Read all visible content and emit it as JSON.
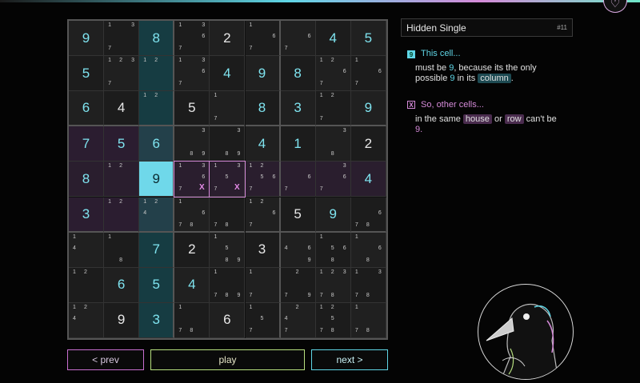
{
  "top_button": {
    "icon": "heart-icon",
    "glyph": "♡"
  },
  "hint": {
    "title": "Hidden Single",
    "number": "#11",
    "step1": {
      "box": "9",
      "title": "This cell...",
      "line1_pre": "must be ",
      "line1_val": "9",
      "line1_post": ", because its the only",
      "line2_pre": "possible ",
      "line2_val": "9",
      "line2_mid": " in its ",
      "line2_chip": "column",
      "line2_post": "."
    },
    "step2": {
      "box": "X",
      "title": "So, other cells...",
      "line1_pre": "in the same ",
      "line1_chip1": "house",
      "line1_mid": " or ",
      "line1_chip2": "row",
      "line1_post": " can't be",
      "line2_val": "9."
    }
  },
  "controls": {
    "prev": "< prev",
    "play": "play",
    "next": "next >"
  },
  "colors": {
    "accent_blue": "#5fd6e6",
    "accent_pink": "#d48ad8",
    "accent_green": "#b7e07f"
  },
  "board": {
    "rows": [
      [
        {
          "v": "9"
        },
        {
          "c": [
            "1",
            "3",
            "7"
          ]
        },
        {
          "v": "8",
          "bg": "col"
        },
        {
          "c": [
            "1",
            "3",
            "6",
            "7"
          ]
        },
        {
          "v": "2",
          "f": 1
        },
        {
          "c": [
            "1",
            "6",
            "7"
          ]
        },
        {
          "c": [
            "6",
            "7"
          ]
        },
        {
          "v": "4"
        },
        {
          "v": "5"
        }
      ],
      [
        {
          "v": "5"
        },
        {
          "c": [
            "1",
            "2",
            "3",
            "7"
          ]
        },
        {
          "c": [
            "1",
            "2"
          ],
          "bg": "col"
        },
        {
          "c": [
            "1",
            "3",
            "6",
            "7"
          ]
        },
        {
          "v": "4"
        },
        {
          "v": "9"
        },
        {
          "v": "8"
        },
        {
          "c": [
            "1",
            "2",
            "6",
            "7"
          ]
        },
        {
          "c": [
            "1",
            "6",
            "7"
          ]
        }
      ],
      [
        {
          "v": "6"
        },
        {
          "v": "4",
          "f": 1
        },
        {
          "c": [
            "1",
            "2"
          ],
          "bg": "col"
        },
        {
          "v": "5",
          "f": 1
        },
        {
          "c": [
            "1",
            "7"
          ]
        },
        {
          "v": "8"
        },
        {
          "v": "3"
        },
        {
          "c": [
            "1",
            "2",
            "7"
          ]
        },
        {
          "v": "9"
        }
      ],
      [
        {
          "v": "7",
          "bg": "box"
        },
        {
          "v": "5",
          "bg": "box"
        },
        {
          "v": "6",
          "bg": "boxcol"
        },
        {
          "c": [
            "3",
            "8",
            "9"
          ]
        },
        {
          "c": [
            "3",
            "8",
            "9"
          ]
        },
        {
          "v": "4"
        },
        {
          "v": "1"
        },
        {
          "c": [
            "3",
            "8"
          ]
        },
        {
          "v": "2",
          "f": 1
        }
      ],
      [
        {
          "v": "8",
          "bg": "row"
        },
        {
          "c": [
            "1",
            "2"
          ],
          "bg": "row"
        },
        {
          "v": "9",
          "bg": "target"
        },
        {
          "c": [
            "1",
            "3",
            "6",
            "7",
            "X"
          ],
          "bg": "rowsel"
        },
        {
          "c": [
            "1",
            "3",
            "5",
            "7",
            "X"
          ],
          "bg": "rowsel"
        },
        {
          "c": [
            "1",
            "2",
            "5",
            "6",
            "7"
          ],
          "bg": "row"
        },
        {
          "c": [
            "6",
            "7"
          ],
          "bg": "row"
        },
        {
          "c": [
            "3",
            "6",
            "7"
          ],
          "bg": "row"
        },
        {
          "v": "4",
          "bg": "row"
        }
      ],
      [
        {
          "v": "3",
          "bg": "box"
        },
        {
          "c": [
            "1",
            "2"
          ],
          "bg": "box"
        },
        {
          "c": [
            "1",
            "2",
            "4"
          ],
          "bg": "boxcol"
        },
        {
          "c": [
            "1",
            "6",
            "7",
            "8"
          ]
        },
        {
          "c": [
            "7",
            "8"
          ]
        },
        {
          "c": [
            "1",
            "2",
            "6",
            "7"
          ]
        },
        {
          "v": "5",
          "f": 1
        },
        {
          "v": "9"
        },
        {
          "c": [
            "6",
            "7",
            "8"
          ]
        }
      ],
      [
        {
          "c": [
            "1",
            "4"
          ]
        },
        {
          "c": [
            "1",
            "8"
          ]
        },
        {
          "v": "7",
          "bg": "col"
        },
        {
          "v": "2",
          "f": 1
        },
        {
          "c": [
            "1",
            "5",
            "8",
            "9"
          ]
        },
        {
          "v": "3",
          "f": 1
        },
        {
          "c": [
            "4",
            "6",
            "9"
          ]
        },
        {
          "c": [
            "1",
            "5",
            "6",
            "8"
          ]
        },
        {
          "c": [
            "1",
            "6",
            "8"
          ]
        }
      ],
      [
        {
          "c": [
            "1",
            "2"
          ]
        },
        {
          "v": "6"
        },
        {
          "v": "5",
          "bg": "col"
        },
        {
          "v": "4"
        },
        {
          "c": [
            "1",
            "7",
            "8",
            "9"
          ]
        },
        {
          "c": [
            "1",
            "7"
          ]
        },
        {
          "c": [
            "2",
            "7",
            "9"
          ]
        },
        {
          "c": [
            "1",
            "2",
            "3",
            "7",
            "8"
          ]
        },
        {
          "c": [
            "1",
            "3",
            "7",
            "8"
          ]
        }
      ],
      [
        {
          "c": [
            "1",
            "2",
            "4"
          ]
        },
        {
          "v": "9",
          "f": 1
        },
        {
          "v": "3",
          "bg": "col"
        },
        {
          "c": [
            "1",
            "7",
            "8"
          ]
        },
        {
          "v": "6",
          "f": 1
        },
        {
          "c": [
            "1",
            "5",
            "7"
          ]
        },
        {
          "c": [
            "2",
            "4",
            "7"
          ]
        },
        {
          "c": [
            "1",
            "2",
            "5",
            "7",
            "8"
          ]
        },
        {
          "c": [
            "1",
            "7",
            "8"
          ]
        }
      ]
    ]
  }
}
